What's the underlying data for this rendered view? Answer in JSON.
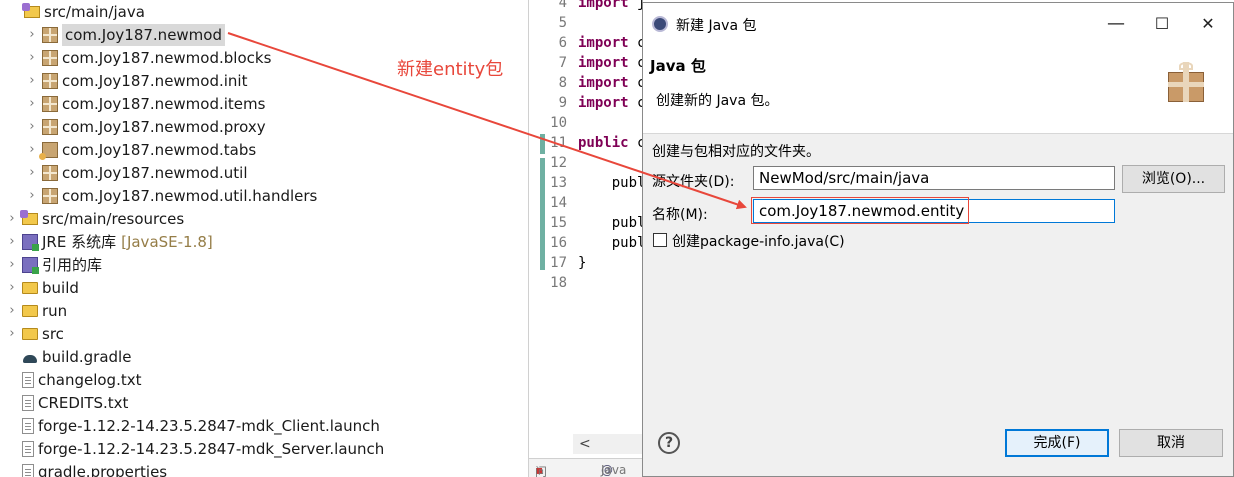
{
  "explorer": {
    "items": [
      {
        "label": "src/main/java",
        "icon": "source-folder-icon",
        "expanded": true,
        "selected": false
      },
      {
        "label": "com.Joy187.newmod",
        "icon": "package-icon",
        "expanded": false,
        "selected": true
      },
      {
        "label": "com.Joy187.newmod.blocks",
        "icon": "package-icon",
        "expanded": false,
        "selected": false
      },
      {
        "label": "com.Joy187.newmod.init",
        "icon": "package-icon",
        "expanded": false,
        "selected": false
      },
      {
        "label": "com.Joy187.newmod.items",
        "icon": "package-icon",
        "expanded": false,
        "selected": false
      },
      {
        "label": "com.Joy187.newmod.proxy",
        "icon": "package-icon",
        "expanded": false,
        "selected": false
      },
      {
        "label": "com.Joy187.newmod.tabs",
        "icon": "package-warning-icon",
        "expanded": false,
        "selected": false
      },
      {
        "label": "com.Joy187.newmod.util",
        "icon": "package-icon",
        "expanded": false,
        "selected": false
      },
      {
        "label": "com.Joy187.newmod.util.handlers",
        "icon": "package-icon",
        "expanded": false,
        "selected": false
      },
      {
        "label": "src/main/resources",
        "icon": "source-folder-icon",
        "expanded": false,
        "selected": false
      },
      {
        "label": "JRE 系统库",
        "suffix": "[JavaSE-1.8]",
        "icon": "library-icon",
        "expanded": false,
        "selected": false
      },
      {
        "label": "引用的库",
        "icon": "library-icon",
        "expanded": false,
        "selected": false
      },
      {
        "label": "build",
        "icon": "folder-icon",
        "expanded": false,
        "selected": false
      },
      {
        "label": "run",
        "icon": "folder-icon",
        "expanded": false,
        "selected": false
      },
      {
        "label": "src",
        "icon": "folder-icon",
        "expanded": false,
        "selected": false
      },
      {
        "label": "build.gradle",
        "icon": "gradle-file-icon",
        "selected": false
      },
      {
        "label": "changelog.txt",
        "icon": "text-file-icon",
        "selected": false
      },
      {
        "label": "CREDITS.txt",
        "icon": "text-file-icon",
        "selected": false
      },
      {
        "label": "forge-1.12.2-14.23.5.2847-mdk_Client.launch",
        "icon": "text-file-icon",
        "selected": false
      },
      {
        "label": "forge-1.12.2-14.23.5.2847-mdk_Server.launch",
        "icon": "text-file-icon",
        "selected": false
      },
      {
        "label": "gradle.properties",
        "icon": "text-file-icon",
        "selected": false
      }
    ]
  },
  "editor": {
    "lines": [
      {
        "n": "4",
        "kw": "import",
        "rest": " java.util.List;"
      },
      {
        "n": "5",
        "kw": "",
        "rest": ""
      },
      {
        "n": "6",
        "kw": "import",
        "rest": " c"
      },
      {
        "n": "7",
        "kw": "import",
        "rest": " c"
      },
      {
        "n": "8",
        "kw": "import",
        "rest": " c"
      },
      {
        "n": "9",
        "kw": "import",
        "rest": " c"
      },
      {
        "n": "10",
        "kw": "",
        "rest": ""
      },
      {
        "n": "11",
        "kw": "public",
        "rest": " c"
      },
      {
        "n": "12",
        "kw": "",
        "rest": ""
      },
      {
        "n": "13",
        "kw": "",
        "rest": "    publ"
      },
      {
        "n": "14",
        "kw": "",
        "rest": ""
      },
      {
        "n": "15",
        "kw": "",
        "rest": "    publ"
      },
      {
        "n": "16",
        "kw": "",
        "rest": "    publ"
      },
      {
        "n": "17",
        "kw": "",
        "rest": "}"
      },
      {
        "n": "18",
        "kw": "",
        "rest": ""
      }
    ],
    "bottom_tabs": [
      "问题",
      "Java"
    ]
  },
  "annotation": {
    "text": "新建entity包",
    "color": "#e8473b"
  },
  "dialog": {
    "title": "新建 Java 包",
    "header_title": "Java 包",
    "header_desc": "创建新的 Java 包。",
    "instruction": "创建与包相对应的文件夹。",
    "source_folder_label": "源文件夹(D):",
    "source_folder_value": "NewMod/src/main/java",
    "browse_label": "浏览(O)...",
    "name_label": "名称(M):",
    "name_value": "com.Joy187.newmod.entity",
    "checkbox_label": "创建package-info.java(C)",
    "checkbox_checked": false,
    "finish_label": "完成(F)",
    "cancel_label": "取消",
    "help_symbol": "?",
    "minimize_symbol": "—",
    "maximize_symbol": "☐",
    "close_symbol": "✕"
  },
  "colors": {
    "accent": "#0078d7",
    "annotation_red": "#e8473b",
    "keyword": "#7f0055"
  }
}
